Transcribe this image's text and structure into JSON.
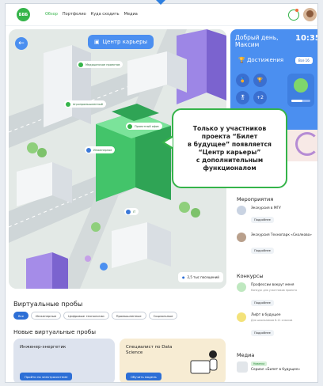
{
  "header": {
    "logo": "БВБ",
    "nav": [
      {
        "label": "Обзор",
        "active": true
      },
      {
        "label": "Портфолио",
        "active": false
      },
      {
        "label": "Куда сходить",
        "active": false
      },
      {
        "label": "Медиа",
        "active": false
      }
    ]
  },
  "hero": {
    "title": "Центр карьеры",
    "visitors": "2,5 тыс посещений",
    "labels": [
      {
        "text": "Медицинское проектов",
        "color": "green"
      },
      {
        "text": "Проектный офис",
        "color": "green"
      },
      {
        "text": "Агропромышленный",
        "color": "green"
      },
      {
        "text": "Инженерное",
        "color": "blue"
      },
      {
        "text": "IT",
        "color": "blue"
      }
    ]
  },
  "callout": {
    "lines": [
      "Только у участников",
      "проекта “Билет",
      "в будущее” появляется",
      "“Центр карьеры”",
      "с дополнительным",
      "функционалом"
    ]
  },
  "sidebar": {
    "greeting_line1": "Добрый день,",
    "greeting_line2": "Максим",
    "time": "10:35",
    "achievements_title": "Достижения",
    "achievements_badge": "Все 16",
    "achievement_more": "+2",
    "progress": 0.6,
    "events_title": "Мероприятия",
    "events": [
      {
        "name": "Экскурсия в МГУ",
        "button": "Подробнее"
      },
      {
        "name": "Экскурсия Технопарк «Сколково»",
        "button": "Подробнее"
      }
    ],
    "contests_title": "Конкурсы",
    "contests": [
      {
        "name": "Профессии вокруг меня",
        "sub": "Конкурс для участников проекта",
        "button": "Подробнее"
      },
      {
        "name": "Лифт в будущее",
        "sub": "Для школьников 8-11 классов",
        "button": "Подробнее"
      }
    ],
    "media_title": "Медиа",
    "media_tag": "Новинка",
    "media_item": "Сериал «Билет в будущее»"
  },
  "trials": {
    "title": "Виртуальные пробы",
    "chips": [
      {
        "label": "Все",
        "active": true
      },
      {
        "label": "Инженерные",
        "active": false
      },
      {
        "label": "Цифровые технологии",
        "active": false
      },
      {
        "label": "Промышленные",
        "active": false
      },
      {
        "label": "Социальные",
        "active": false
      }
    ],
    "new_title": "Новые виртуальные пробы",
    "cards": [
      {
        "title": "Инженер-энергетик",
        "button": "Пройти по электросистеме",
        "bg": "#dde3ee"
      },
      {
        "title": "Специалист по Data Science",
        "button": "Обучить модель",
        "bg": "#f7ecd3"
      }
    ]
  },
  "colors": {
    "accent_green": "#35b44a",
    "accent_blue": "#4b8ff0",
    "primary_button": "#2d6fd6"
  }
}
